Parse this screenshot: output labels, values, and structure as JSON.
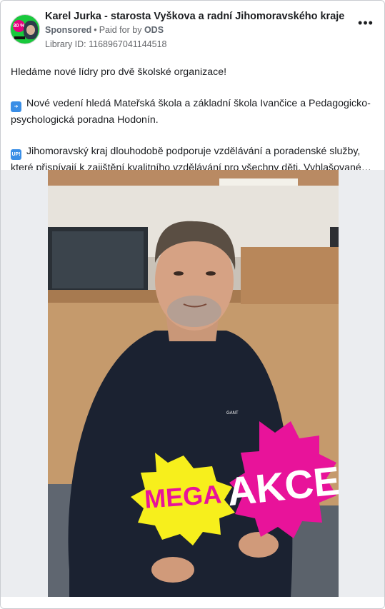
{
  "post": {
    "page_name": "Karel Jurka - starosta Vyškova a radní Jihomoravského kraje",
    "sponsored": "Sponsored",
    "paid_for_prefix": "Paid for by",
    "payer": "ODS",
    "library_id": "Library ID: 1168967041144518",
    "more_menu": "•••",
    "avatar_badge": "30 %"
  },
  "body": {
    "intro": "Hledáme nové lídry pro dvě školské organizace!",
    "para2_emoji": "➡️",
    "para2": "Nové vedení hledá Mateřská škola a základní škola Ivančice a Pedagogicko-psychologická poradna Hodonín.",
    "para3_emoji": "UP!",
    "para3": "Jihomoravský kraj dlouhodobě podporuje vzdělávání a poradenské služby, které přispívají k zajištění kvalitního vzdělávání pro všechny děti. Vyhlašované…"
  },
  "image": {
    "sticker_left": "MEGA",
    "sticker_right": "AKCE",
    "shirt_logo": "GANT",
    "colors": {
      "yellow": "#f7ef1c",
      "pink": "#e8139a",
      "sweater": "#1b2231"
    }
  },
  "icons": {
    "more": "more-horizontal-icon",
    "avatar": "profile-avatar-icon"
  }
}
